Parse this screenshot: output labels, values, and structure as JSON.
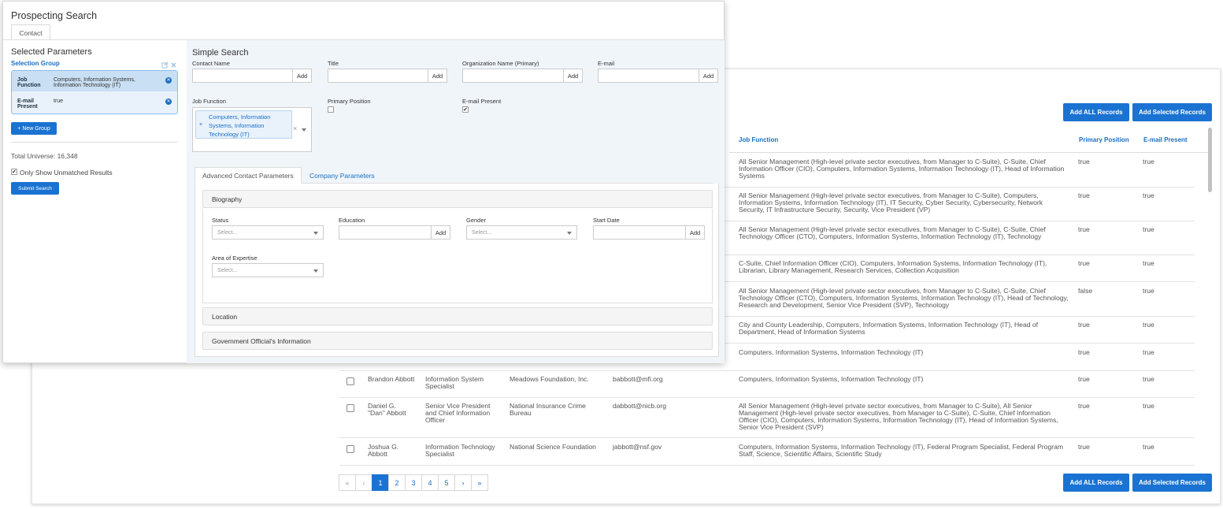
{
  "modal": {
    "title": "Prospecting Search",
    "tab_contact": "Contact"
  },
  "left": {
    "selected_parameters": "Selected Parameters",
    "selection_group": "Selection Group",
    "groups": [
      {
        "key": "Job Function",
        "value": "Computers, Information Systems, Information Technology (IT)"
      },
      {
        "key": "E-mail Present",
        "value": "true"
      }
    ],
    "new_group_label": "+ New Group",
    "total_universe": "Total Universe: 16,348",
    "only_unmatched_label": "Only Show Unmatched Results",
    "submit_label": "Submit Search"
  },
  "simple": {
    "heading": "Simple Search",
    "contact_name_label": "Contact Name",
    "title_label": "Title",
    "org_label": "Organization Name (Primary)",
    "email_label": "E-mail",
    "add_label": "Add",
    "job_function_label": "Job Function",
    "job_function_chip": "Computers, Information Systems, Information Technology (IT)",
    "chip_remove": "×",
    "clear_symbol": "×",
    "primary_position_label": "Primary Position",
    "email_present_label": "E-mail Present",
    "check_mark": "✔"
  },
  "advanced": {
    "tab_advanced": "Advanced Contact Parameters",
    "tab_company": "Company Parameters",
    "biography": "Biography",
    "status_label": "Status",
    "education_label": "Education",
    "gender_label": "Gender",
    "start_date_label": "Start Date",
    "area_label": "Area of Expertise",
    "select_placeholder": "Select...",
    "location": "Location",
    "gov_info": "Government Official's Information"
  },
  "results": {
    "add_all_label": "Add ALL Records",
    "add_selected_label": "Add Selected Records",
    "headers": {
      "job_function": "Job Function",
      "primary_position": "Primary Position",
      "email_present": "E-mail Present"
    },
    "rows": [
      {
        "first": "",
        "title": "",
        "org": "",
        "email": "",
        "job": "All Senior Management (High-level private sector executives, from Manager to C-Suite), C-Suite, Chief Information Officer (CIO), Computers, Information Systems, Information Technology (IT), Head of Information Systems",
        "pp": "true",
        "ep": "true"
      },
      {
        "first": "",
        "title": "",
        "org": "",
        "email": "",
        "job": "All Senior Management (High-level private sector executives, from Manager to C-Suite), Computers, Information Systems, Information Technology (IT), IT Security, Cyber Security, Cybersecurity, Network Security, IT Infrastructure Security, Security, Vice President (VP)",
        "pp": "true",
        "ep": "true"
      },
      {
        "first": "",
        "title": "",
        "org": "",
        "email": "",
        "job": "All Senior Management (High-level private sector executives, from Manager to C-Suite), C-Suite, Chief Technology Officer (CTO), Computers, Information Systems, Information Technology (IT), Technology",
        "pp": "true",
        "ep": "true"
      },
      {
        "first": "",
        "title": "",
        "org": "",
        "email": "",
        "job": "C-Suite, Chief Information Officer (CIO), Computers, Information Systems, Information Technology (IT), Librarian, Library Management, Research Services, Collection Acquisition",
        "pp": "true",
        "ep": "true"
      },
      {
        "first": "",
        "title": "",
        "org": "",
        "email": "",
        "job": "All Senior Management (High-level private sector executives, from Manager to C-Suite), C-Suite, Chief Technology Officer (CTO), Computers, Information Systems, Information Technology (IT), Head of Technology, Research and Development, Senior Vice President (SVP), Technology",
        "pp": "false",
        "ep": "true"
      },
      {
        "first": "",
        "title": "",
        "org": "",
        "email": "",
        "job": "City and County Leadership, Computers, Information Systems, Information Technology (IT), Head of Department, Head of Information Systems",
        "pp": "true",
        "ep": "true"
      },
      {
        "first": "",
        "title": "",
        "org": "",
        "email": "",
        "job": "Computers, Information Systems, Information Technology (IT)",
        "pp": "true",
        "ep": "true"
      },
      {
        "first": "Brandon Abbott",
        "title": "Information System Specialist",
        "org": "Meadows Foundation, Inc.",
        "email": "babbott@mfi.org",
        "job": "Computers, Information Systems, Information Technology (IT)",
        "pp": "true",
        "ep": "true"
      },
      {
        "first": "Daniel G. \"Dan\" Abbott",
        "title": "Senior Vice President and Chief Information Officer",
        "org": "National Insurance Crime Bureau",
        "email": "dabbott@nicb.org",
        "job": "All Senior Management (High-level private sector executives, from Manager to C-Suite), All Senior Management (High-level private sector executives, from Manager to C-Suite), C-Suite, Chief Information Officer (CIO), Computers, Information Systems, Information Technology (IT), Head of Information Systems, Senior Vice President (SVP)",
        "pp": "true",
        "ep": "true"
      },
      {
        "first": "Joshua G. Abbott",
        "title": "Information Technology Specialist",
        "org": "National Science Foundation",
        "email": "jabbott@nsf.gov",
        "job": "Computers, Information Systems, Information Technology (IT), Federal Program Specialist, Federal Program Staff, Science, Scientific Affairs, Scientific Study",
        "pp": "true",
        "ep": "true"
      }
    ],
    "pagination": [
      "«",
      "‹",
      "1",
      "2",
      "3",
      "4",
      "5",
      "›",
      "»"
    ]
  },
  "colors": {
    "accent": "#1a73d2",
    "link": "#1a6fc4",
    "pane_bg": "#f0f5fa"
  }
}
